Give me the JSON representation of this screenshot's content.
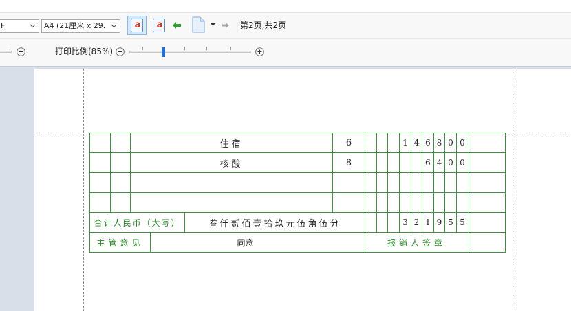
{
  "toolbar": {
    "printer_select": {
      "value": "F",
      "icon": "chevron-down-icon"
    },
    "paper_select": {
      "value": "A4 (21厘米 x 29.",
      "icon": "chevron-down-icon"
    },
    "orientation_buttons": [
      {
        "icon": "portrait-page-icon",
        "glyph": "a",
        "selected": true
      },
      {
        "icon": "landscape-page-icon",
        "glyph": "a",
        "selected": false
      }
    ],
    "prev_page_icon": "arrow-left-icon",
    "page_menu_icon": "page-icon",
    "page_menu_caret_icon": "caret-down-icon",
    "next_page_icon": "arrow-right-icon",
    "page_indicator": "第2页,共2页"
  },
  "zoom_bar": {
    "zoom_label": "打印比例(85%)",
    "slider_level": 0.28,
    "zoom_out_icon": "zoom-out-icon",
    "zoom_in_icon": "zoom-in-icon"
  },
  "voucher": {
    "items": [
      {
        "name": "住宿",
        "quantity": "6",
        "amount_digits": [
          "",
          "",
          "",
          "1",
          "4",
          "6",
          "8",
          "0",
          "0"
        ]
      },
      {
        "name": "核酸",
        "quantity": "8",
        "amount_digits": [
          "",
          "",
          "",
          "",
          "",
          "6",
          "4",
          "0",
          "0"
        ]
      },
      {
        "name": "",
        "quantity": "",
        "amount_digits": [
          "",
          "",
          "",
          "",
          "",
          "",
          "",
          "",
          ""
        ]
      },
      {
        "name": "",
        "quantity": "",
        "amount_digits": [
          "",
          "",
          "",
          "",
          "",
          "",
          "",
          "",
          ""
        ]
      }
    ],
    "total": {
      "label": "合计人民币（大写）",
      "amount_in_words": "叁仟贰佰壹拾玖元伍角伍分",
      "amount_digits": [
        "",
        "",
        "",
        "3",
        "2",
        "1",
        "9",
        "5",
        "5"
      ]
    },
    "approval": {
      "label": "主管意见",
      "opinion": "同意",
      "signature_label": "报销人签章"
    }
  },
  "colors": {
    "table_line": "#3f8f3f",
    "label_text": "#2f8a2f",
    "prev_arrow": "#2e9e2e",
    "next_arrow": "#a8a8a8",
    "slider_thumb": "#1f6fd6",
    "selected_button_bg": "#d4e7fb",
    "workspace_bg": "#d8dfe8",
    "orientation_glyph": "#c0392b"
  }
}
